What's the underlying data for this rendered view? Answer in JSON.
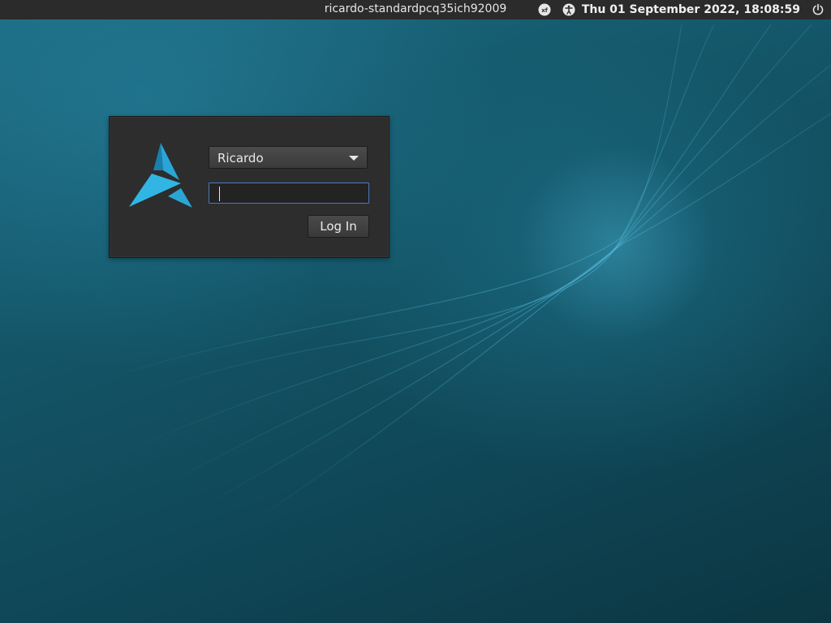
{
  "panel": {
    "hostname": "ricardo-standardpcq35ich92009",
    "clock": "Thu 01 September 2022, 18:08:59",
    "icons": [
      "keyboard-layout-icon",
      "accessibility-icon",
      "power-icon"
    ],
    "keyboard_layout_label": "xf"
  },
  "login": {
    "selected_user": "Ricardo",
    "user_options": [
      "Ricardo"
    ],
    "password_value": "",
    "login_button_label": "Log In"
  },
  "colors": {
    "panel_bg": "#2b2b2b",
    "box_bg": "#2d2d2d",
    "focus_border": "#4a78c0",
    "logo_blue": "#2aa6d6"
  }
}
